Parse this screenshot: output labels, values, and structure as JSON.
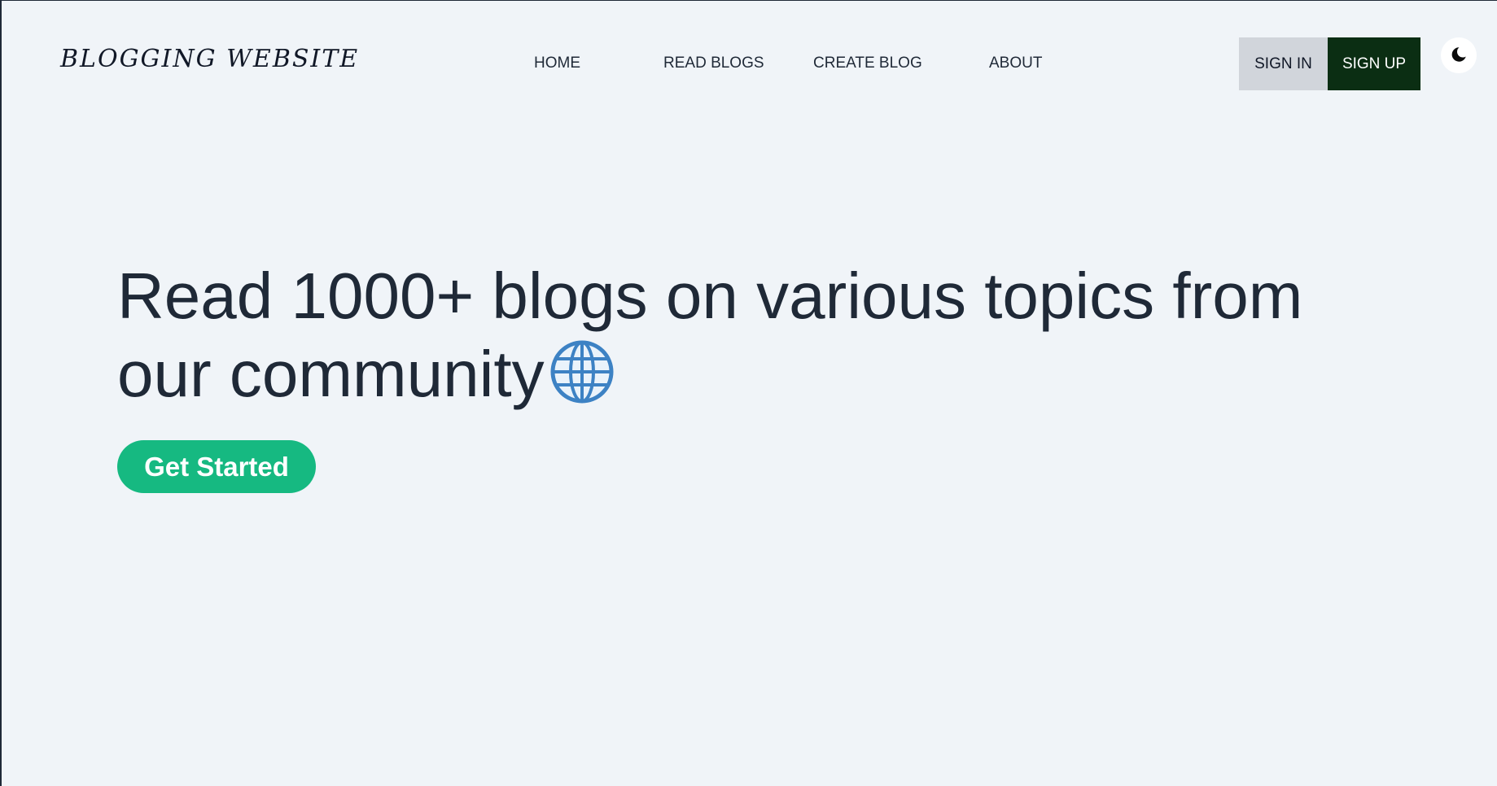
{
  "header": {
    "brand": "BLOGGING WEBSITE",
    "nav": {
      "home": "HOME",
      "read_blogs": "READ BLOGS",
      "create_blog": "CREATE BLOG",
      "about": "ABOUT"
    },
    "sign_in_label": "SIGN IN",
    "sign_up_label": "SIGN UP",
    "theme_toggle_icon": "moon-icon"
  },
  "hero": {
    "title": "Read 1000+ blogs on various topics from our community",
    "title_icon": "globe-icon",
    "cta_label": "Get Started"
  },
  "colors": {
    "background": "#f0f4f8",
    "text": "#1f2937",
    "sign_in_bg": "#d1d5db",
    "sign_up_bg": "#0b2e13",
    "cta_bg": "#16b981",
    "globe": "#3d82c4"
  }
}
